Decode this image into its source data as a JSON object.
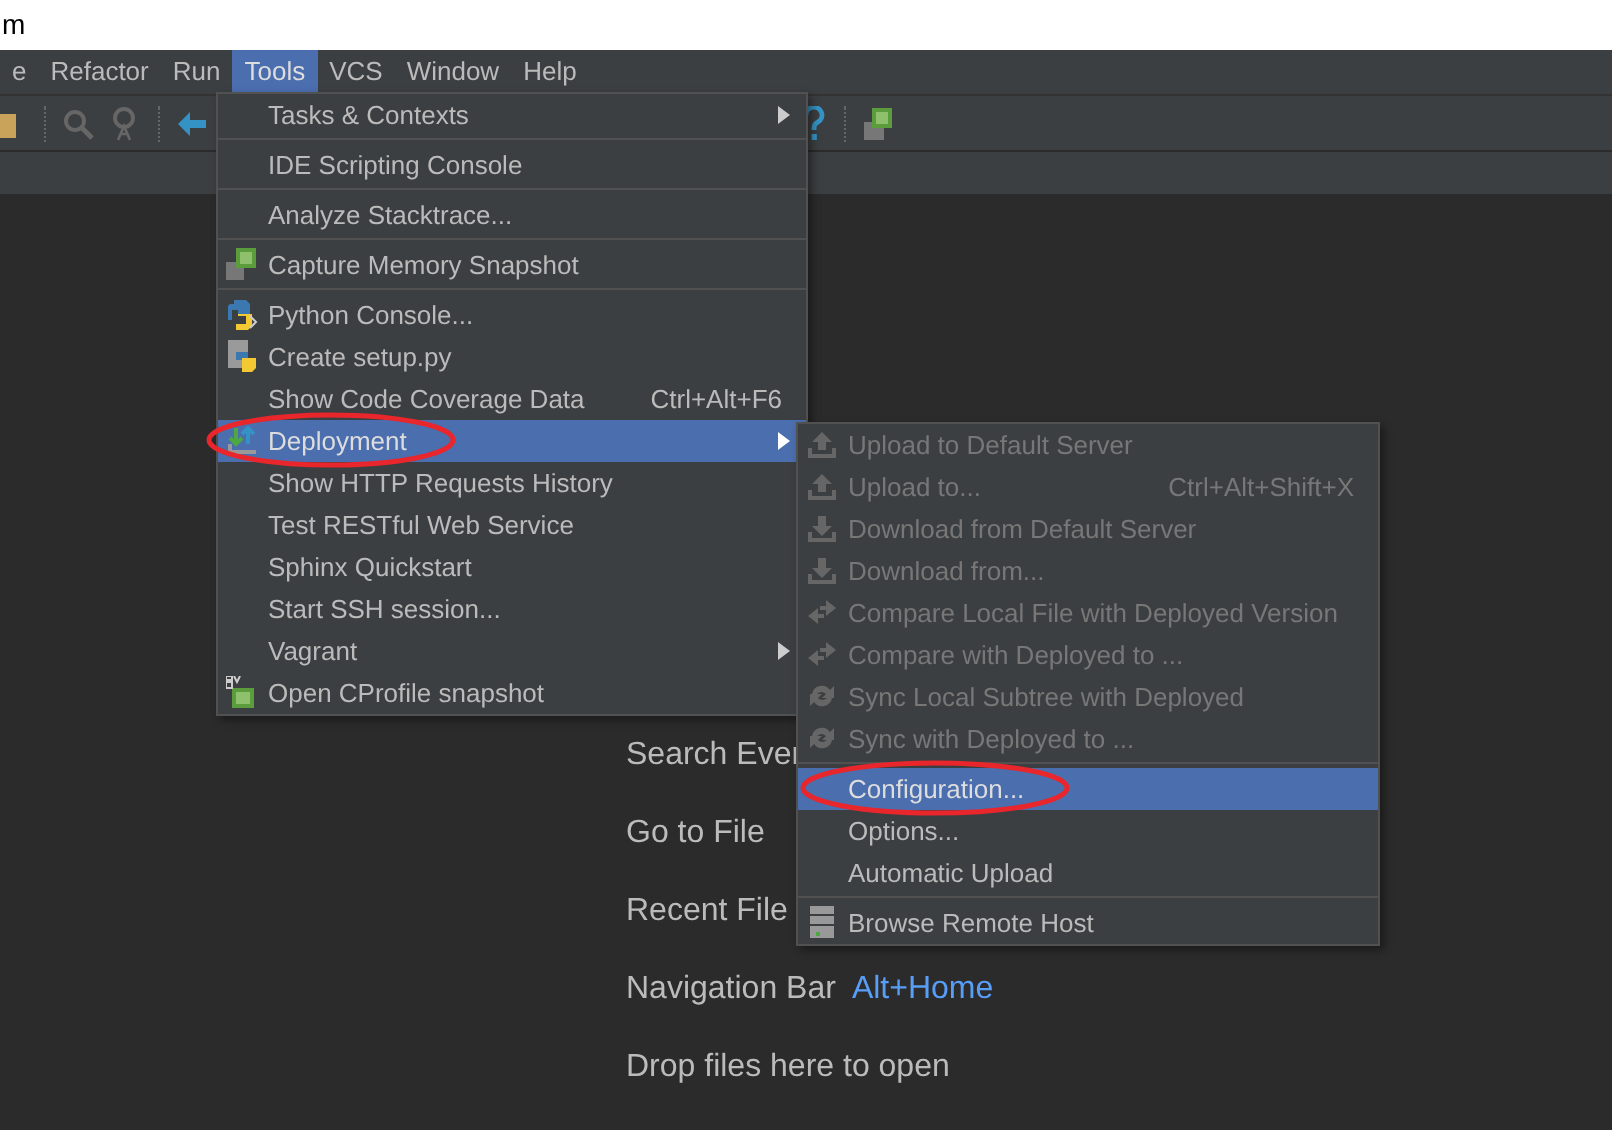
{
  "title_fragment": "m",
  "menubar": [
    {
      "label": "e",
      "selected": false
    },
    {
      "label": "Refactor",
      "selected": false
    },
    {
      "label": "Run",
      "selected": false
    },
    {
      "label": "Tools",
      "selected": true
    },
    {
      "label": "VCS",
      "selected": false
    },
    {
      "label": "Window",
      "selected": false
    },
    {
      "label": "Help",
      "selected": false
    }
  ],
  "tools_menu": [
    {
      "kind": "item",
      "label": "Tasks & Contexts",
      "submenu": true,
      "selected": false,
      "circled": false
    },
    {
      "kind": "separator"
    },
    {
      "kind": "item",
      "label": "IDE Scripting Console",
      "selected": false,
      "circled": false
    },
    {
      "kind": "separator"
    },
    {
      "kind": "item",
      "label": "Analyze Stacktrace...",
      "selected": false,
      "circled": false
    },
    {
      "kind": "separator"
    },
    {
      "kind": "item",
      "label": "Capture Memory Snapshot",
      "selected": false,
      "circled": false
    },
    {
      "kind": "separator"
    },
    {
      "kind": "item",
      "label": "Python Console...",
      "selected": false,
      "circled": false
    },
    {
      "kind": "item",
      "label": "Create setup.py",
      "selected": false,
      "circled": false
    },
    {
      "kind": "item",
      "label": "Show Code Coverage Data",
      "shortcut": "Ctrl+Alt+F6",
      "selected": false,
      "circled": false
    },
    {
      "kind": "item",
      "label": "Deployment",
      "submenu": true,
      "selected": true,
      "circled": true
    },
    {
      "kind": "item",
      "label": "Show HTTP Requests History",
      "selected": false,
      "circled": false
    },
    {
      "kind": "item",
      "label": "Test RESTful Web Service",
      "selected": false,
      "circled": false
    },
    {
      "kind": "item",
      "label": "Sphinx Quickstart",
      "selected": false,
      "circled": false
    },
    {
      "kind": "item",
      "label": "Start SSH session...",
      "selected": false,
      "circled": false
    },
    {
      "kind": "item",
      "label": "Vagrant",
      "submenu": true,
      "selected": false,
      "circled": false
    },
    {
      "kind": "item",
      "label": "Open CProfile snapshot",
      "selected": false,
      "circled": false
    }
  ],
  "deployment_submenu": [
    {
      "kind": "item",
      "label": "Upload to Default Server",
      "selected": false,
      "disabled": true,
      "circled": false
    },
    {
      "kind": "item",
      "label": "Upload to...",
      "shortcut": "Ctrl+Alt+Shift+X",
      "selected": false,
      "disabled": true,
      "circled": false
    },
    {
      "kind": "item",
      "label": "Download from Default Server",
      "selected": false,
      "disabled": true,
      "circled": false
    },
    {
      "kind": "item",
      "label": "Download from...",
      "selected": false,
      "disabled": true,
      "circled": false
    },
    {
      "kind": "item",
      "label": "Compare Local File with Deployed Version",
      "selected": false,
      "disabled": true,
      "circled": false
    },
    {
      "kind": "item",
      "label": "Compare with Deployed to ...",
      "selected": false,
      "disabled": true,
      "circled": false
    },
    {
      "kind": "item",
      "label": "Sync Local Subtree with Deployed",
      "selected": false,
      "disabled": true,
      "circled": false
    },
    {
      "kind": "item",
      "label": "Sync with Deployed to ...",
      "selected": false,
      "disabled": true,
      "circled": false
    },
    {
      "kind": "separator"
    },
    {
      "kind": "item",
      "label": "Configuration...",
      "selected": true,
      "disabled": false,
      "circled": true
    },
    {
      "kind": "item",
      "label": "Options...",
      "selected": false,
      "disabled": false,
      "circled": false
    },
    {
      "kind": "item",
      "label": "Automatic Upload",
      "selected": false,
      "disabled": false,
      "circled": false
    },
    {
      "kind": "separator"
    },
    {
      "kind": "item",
      "label": "Browse Remote Host",
      "selected": false,
      "disabled": false,
      "circled": false
    }
  ],
  "welcome": [
    {
      "label": "Search Ever"
    },
    {
      "label": "Go to File"
    },
    {
      "label": "Recent File"
    },
    {
      "label": "Navigation Bar",
      "shortcut": "Alt+Home"
    },
    {
      "label": "Drop files here to open"
    }
  ]
}
